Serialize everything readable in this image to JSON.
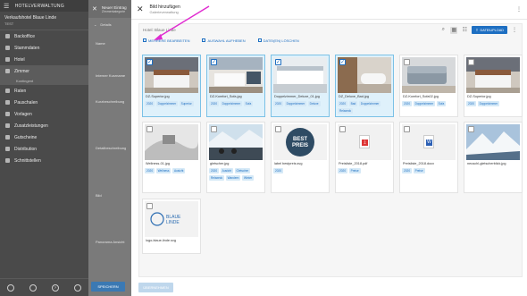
{
  "sidebar": {
    "title": "HOTELVERWALTUNG",
    "hotel_name": "Verkaufshotel Blaue Linde",
    "hotel_sub": "TEST",
    "items": [
      {
        "label": "Backoffice"
      },
      {
        "label": "Stammdaten"
      },
      {
        "label": "Hotel"
      },
      {
        "label": "Zimmer"
      },
      {
        "label": "Raten"
      },
      {
        "label": "Pauschalen"
      },
      {
        "label": "Vorlagen"
      },
      {
        "label": "Zusatzleistungen"
      },
      {
        "label": "Gutscheine"
      },
      {
        "label": "Distribution"
      },
      {
        "label": "Schnittstellen"
      }
    ],
    "sub_item": "Kontingent"
  },
  "middle": {
    "title": "Neuer Eintrag",
    "subtitle": "Zimmerkategorie",
    "details": "Details",
    "labels": [
      "Name",
      "Interner Kurzname",
      "Kurzbeschreibung",
      "Detailbeschreibung",
      "Bild",
      "Panorama Ansicht"
    ],
    "save": "SPEICHERN"
  },
  "modal": {
    "title": "Bild hinzufügen",
    "subtitle": "Galerieverwaltung",
    "folder": "Hotel: Blaue Linde",
    "upload": "DATEIUPLOAD",
    "actions": {
      "edit_multiple": "MEHRERE BEARBEITEN",
      "clear_selection": "AUSWAHL AUFHEBEN",
      "delete_files": "DATEI(EN) LÖSCHEN"
    },
    "apply": "ÜBERNEHMEN"
  },
  "files": [
    {
      "name": "DZ-Superior.jpg",
      "tags": [
        "2020",
        "Doppelzimmer",
        "Superior"
      ],
      "selected": true,
      "kind": "bedroom"
    },
    {
      "name": "DZ-Komfort_Sofa.jpg",
      "tags": [
        "2020",
        "Doppelzimmer",
        "Sofa"
      ],
      "selected": true,
      "kind": "bedroom2"
    },
    {
      "name": "Doppelzimmer_Deluxe_01.jpg",
      "tags": [
        "2020",
        "Doppelzimmer",
        "Deluxe"
      ],
      "selected": true,
      "kind": "bed3"
    },
    {
      "name": "DZ_Deluxe_Bad.jpg",
      "tags": [
        "2020",
        "Bad",
        "Doppelzimmer",
        "Relaxeck"
      ],
      "selected": true,
      "kind": "bath"
    },
    {
      "name": "DZ-Komfort_Sofa02.jpg",
      "tags": [
        "2020",
        "Doppelzimmer",
        "Sofa"
      ],
      "selected": false,
      "kind": "sofa"
    },
    {
      "name": "DZ-Superior.jpg",
      "tags": [
        "2020",
        "Doppelzimmer"
      ],
      "selected": false,
      "kind": "bedroom"
    },
    {
      "name": "Wellness-01.jpg",
      "tags": [
        "2020",
        "Wellness",
        "Ausicht"
      ],
      "selected": false,
      "kind": "wellness"
    },
    {
      "name": "gletscher.jpg",
      "tags": [
        "2020",
        "Ausicht",
        "Gletscher",
        "Relaxeck",
        "Wandern",
        "Winter"
      ],
      "selected": false,
      "kind": "glacier"
    },
    {
      "name": "label bestpreis.svg",
      "tags": [
        "2020"
      ],
      "selected": false,
      "kind": "label",
      "label_text": [
        "BEST",
        "PREIS"
      ]
    },
    {
      "name": "Preisliste_2018.pdf",
      "tags": [
        "2020",
        "Preise"
      ],
      "selected": false,
      "kind": "pdf"
    },
    {
      "name": "Preisliste_2018.docx",
      "tags": [
        "2020",
        "Preise"
      ],
      "selected": false,
      "kind": "docx"
    },
    {
      "name": "neuschl-gletscherblick.jpg",
      "tags": [],
      "selected": false,
      "kind": "mountain"
    },
    {
      "name": "logo-blaue-linde.svg",
      "tags": [],
      "selected": false,
      "kind": "logo",
      "logo_text": [
        "BLAUE",
        "LINDE"
      ]
    }
  ]
}
